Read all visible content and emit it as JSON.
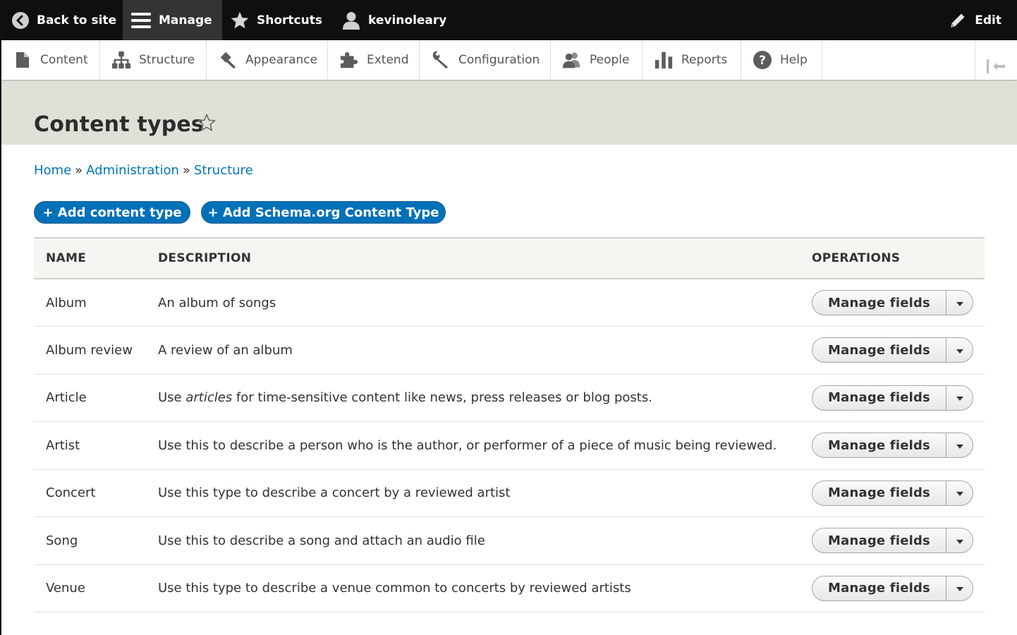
{
  "toolbar": {
    "back_label": "Back to site",
    "manage_label": "Manage",
    "shortcuts_label": "Shortcuts",
    "user_label": "kevinoleary",
    "edit_label": "Edit"
  },
  "tray": {
    "items": [
      {
        "label": "Content",
        "icon": "file-icon"
      },
      {
        "label": "Structure",
        "icon": "sitemap-icon"
      },
      {
        "label": "Appearance",
        "icon": "paintbrush-icon"
      },
      {
        "label": "Extend",
        "icon": "puzzle-icon"
      },
      {
        "label": "Configuration",
        "icon": "wrench-icon"
      },
      {
        "label": "People",
        "icon": "people-icon"
      },
      {
        "label": "Reports",
        "icon": "bar-chart-icon"
      },
      {
        "label": "Help",
        "icon": "help-icon"
      }
    ]
  },
  "page": {
    "title": "Content types"
  },
  "breadcrumb": {
    "items": [
      "Home",
      "Administration",
      "Structure"
    ],
    "separator": "»"
  },
  "actions": {
    "add_content_type": "+ Add content type",
    "add_schema_type": "+ Add Schema.org Content Type"
  },
  "table": {
    "headers": {
      "name": "NAME",
      "description": "DESCRIPTION",
      "operations": "OPERATIONS"
    },
    "op_label": "Manage fields",
    "rows": [
      {
        "name": "Album",
        "desc_pre": "An album of songs",
        "desc_em": "",
        "desc_post": ""
      },
      {
        "name": "Album review",
        "desc_pre": "A review of an album",
        "desc_em": "",
        "desc_post": ""
      },
      {
        "name": "Article",
        "desc_pre": "Use ",
        "desc_em": "articles",
        "desc_post": " for time-sensitive content like news, press releases or blog posts."
      },
      {
        "name": "Artist",
        "desc_pre": "Use this to describe a person who is the author, or performer of a piece of music being reviewed.",
        "desc_em": "",
        "desc_post": ""
      },
      {
        "name": "Concert",
        "desc_pre": "Use this type to describe a concert by a reviewed artist",
        "desc_em": "",
        "desc_post": ""
      },
      {
        "name": "Song",
        "desc_pre": "Use this to describe a song and attach an audio file",
        "desc_em": "",
        "desc_post": ""
      },
      {
        "name": "Venue",
        "desc_pre": "Use this type to describe a venue common to concerts by reviewed artists",
        "desc_em": "",
        "desc_post": ""
      }
    ]
  },
  "colors": {
    "toolbar_bg": "#0f0f0f",
    "manage_active_bg": "#333333",
    "header_band_bg": "#e0e0d8",
    "link": "#0074bd",
    "primary_button": "#0071b8"
  }
}
